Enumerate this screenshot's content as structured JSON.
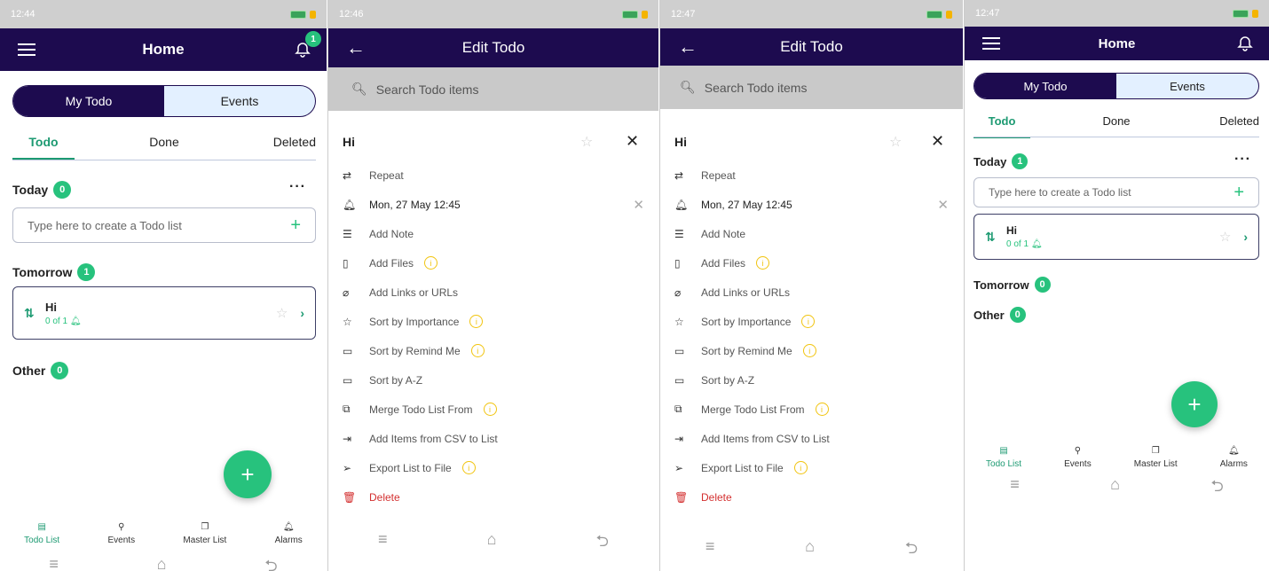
{
  "colors": {
    "primary": "#1d0b4f",
    "accent": "#27c27d",
    "danger": "#d32f2f",
    "info": "#f1c40f"
  },
  "screen1": {
    "status_time": "12:44",
    "title": "Home",
    "bell_badge": "1",
    "segments": [
      "My Todo",
      "Events"
    ],
    "tabs": [
      "Todo",
      "Done",
      "Deleted"
    ],
    "sections": [
      {
        "label": "Today",
        "count": "0"
      },
      {
        "label": "Tomorrow",
        "count": "1"
      },
      {
        "label": "Other",
        "count": "0"
      }
    ],
    "input_placeholder": "Type here to create a Todo list",
    "card": {
      "name": "Hi",
      "progress": "0 of 1"
    },
    "nav": [
      "Todo List",
      "Events",
      "Master List",
      "Alarms"
    ]
  },
  "screen2": {
    "status_time": "12:46",
    "title": "Edit Todo",
    "search_placeholder": "Search Todo items",
    "item_name": "Hi",
    "menu": [
      {
        "label": "Repeat",
        "icon": "repeat-icon",
        "info": false
      },
      {
        "label": "Mon, 27 May 12:45",
        "icon": "bell-icon",
        "info": false,
        "clear": true
      },
      {
        "label": "Add Note",
        "icon": "note-icon",
        "info": false
      },
      {
        "label": "Add Files",
        "icon": "file-icon",
        "info": true
      },
      {
        "label": "Add Links or URLs",
        "icon": "link-icon",
        "info": false
      },
      {
        "label": "Sort by Importance",
        "icon": "star-icon",
        "info": true
      },
      {
        "label": "Sort by Remind Me",
        "icon": "calendar-icon",
        "info": true
      },
      {
        "label": "Sort by A-Z",
        "icon": "calendar-icon",
        "info": false
      },
      {
        "label": "Merge Todo List From",
        "icon": "merge-icon",
        "info": true
      },
      {
        "label": "Add Items from CSV to List",
        "icon": "import-icon",
        "info": false
      },
      {
        "label": "Export List to File",
        "icon": "send-icon",
        "info": true
      },
      {
        "label": "Delete",
        "icon": "trash-icon",
        "info": false
      }
    ]
  },
  "screen3": {
    "status_time": "12:47",
    "title": "Edit Todo",
    "search_placeholder": "Search Todo items",
    "item_name": "Hi"
  },
  "screen4": {
    "status_time": "12:47",
    "title": "Home",
    "segments": [
      "My Todo",
      "Events"
    ],
    "tabs": [
      "Todo",
      "Done",
      "Deleted"
    ],
    "sections": [
      {
        "label": "Today",
        "count": "1"
      },
      {
        "label": "Tomorrow",
        "count": "0"
      },
      {
        "label": "Other",
        "count": "0"
      }
    ],
    "input_placeholder": "Type here to create a Todo list",
    "card": {
      "name": "Hi",
      "progress": "0 of 1"
    },
    "nav": [
      "Todo List",
      "Events",
      "Master List",
      "Alarms"
    ]
  }
}
